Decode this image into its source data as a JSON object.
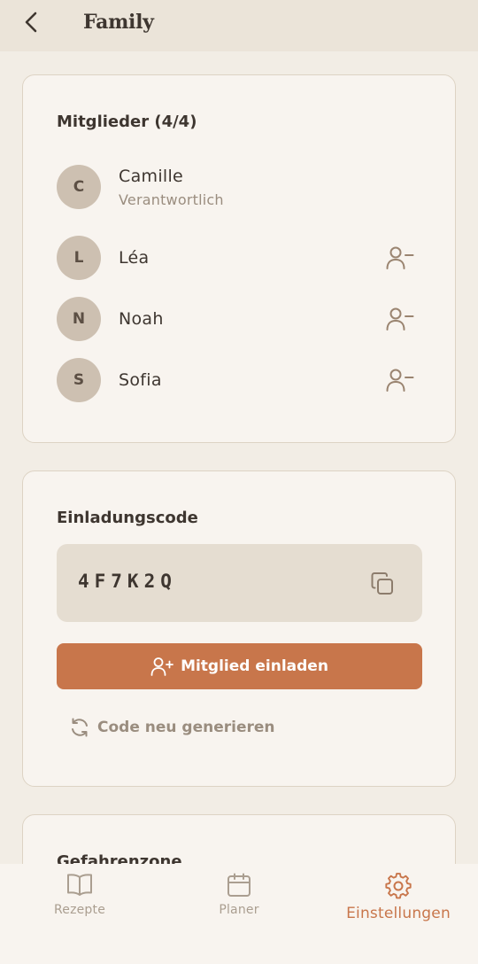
{
  "header": {
    "title": "Family",
    "back_icon": "chevron-left-icon"
  },
  "members_card": {
    "title": "Mitglieder (4/4)",
    "members": [
      {
        "initial": "C",
        "name": "Camille",
        "role": "Verantwortlich",
        "removable": false
      },
      {
        "initial": "L",
        "name": "Léa",
        "role": "",
        "removable": true
      },
      {
        "initial": "N",
        "name": "Noah",
        "role": "",
        "removable": true
      },
      {
        "initial": "S",
        "name": "Sofia",
        "role": "",
        "removable": true
      }
    ],
    "remove_icon": "user-minus-icon"
  },
  "invite_card": {
    "title": "Einladungscode",
    "code": "4F7K2Q",
    "copy_icon": "copy-icon",
    "invite_button_label": "Mitglied einladen",
    "invite_icon": "user-plus-icon",
    "regenerate_label": "Code neu generieren",
    "regenerate_icon": "refresh-icon"
  },
  "danger_card": {
    "title": "Gefahrenzone"
  },
  "bottom_nav": {
    "items": [
      {
        "label": "Rezepte",
        "icon": "book-icon",
        "active": false
      },
      {
        "label": "Planer",
        "icon": "calendar-icon",
        "active": false
      },
      {
        "label": "Einstellungen",
        "icon": "gear-icon",
        "active": true
      }
    ]
  },
  "colors": {
    "background": "#f2ede5",
    "header": "#ebe4d9",
    "card": "#f8f4ef",
    "accent": "#c8764b",
    "avatar": "#cdc0b1",
    "muted_text": "#9a8d7f"
  }
}
